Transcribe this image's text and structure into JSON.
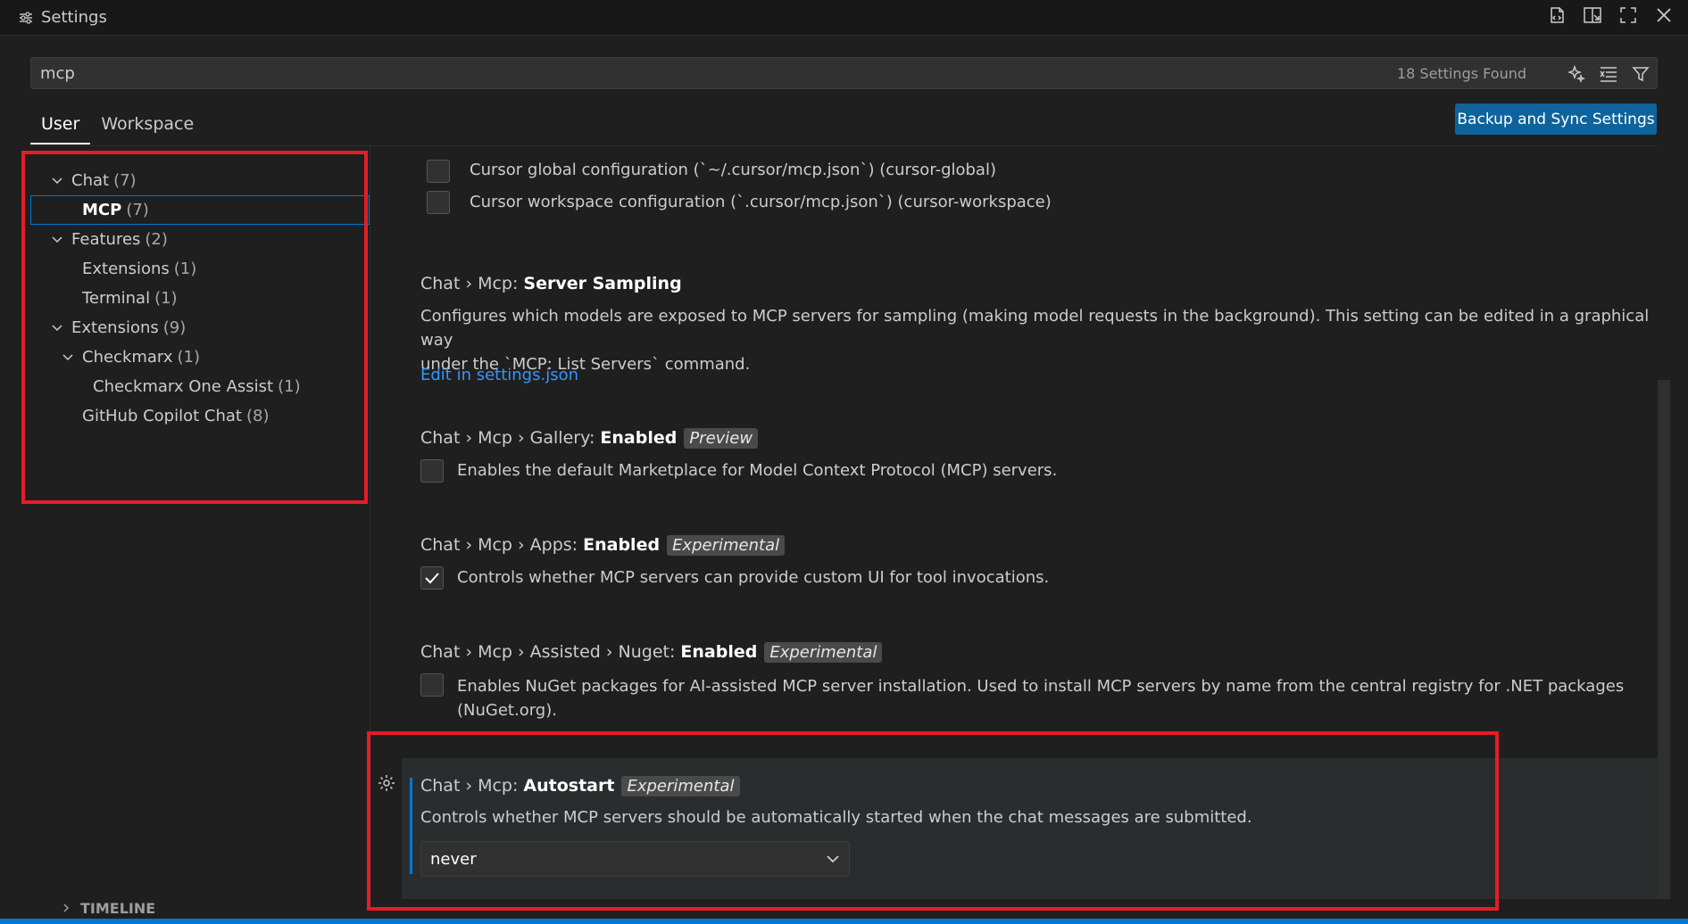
{
  "window": {
    "title": "Settings"
  },
  "search": {
    "value": "mcp",
    "found": "18 Settings Found"
  },
  "tabs": [
    {
      "label": "User",
      "active": true
    },
    {
      "label": "Workspace",
      "active": false
    }
  ],
  "sync_button": "Backup and Sync Settings",
  "toc": [
    {
      "label": "Chat",
      "count": "(7)",
      "level": 0,
      "expanded": true
    },
    {
      "label": "MCP",
      "count": "(7)",
      "level": 1,
      "selected": true
    },
    {
      "label": "Features",
      "count": "(2)",
      "level": 0,
      "expanded": true
    },
    {
      "label": "Extensions",
      "count": "(1)",
      "level": 1
    },
    {
      "label": "Terminal",
      "count": "(1)",
      "level": 1
    },
    {
      "label": "Extensions",
      "count": "(9)",
      "level": 0,
      "expanded": true
    },
    {
      "label": "Checkmarx",
      "count": "(1)",
      "level": 1,
      "expanded": true
    },
    {
      "label": "Checkmarx One Assist",
      "count": "(1)",
      "level": 2
    },
    {
      "label": "GitHub Copilot Chat",
      "count": "(8)",
      "level": 1
    }
  ],
  "settings": {
    "cursor_global": {
      "label": "Cursor global configuration (`~/.cursor/mcp.json`) (cursor-global)",
      "checked": false
    },
    "cursor_workspace": {
      "label": "Cursor workspace configuration (`.cursor/mcp.json`) (cursor-workspace)",
      "checked": false
    },
    "server_sampling": {
      "prefix": "Chat › Mcp: ",
      "name": "Server Sampling",
      "desc_line1": "Configures which models are exposed to MCP servers for sampling (making model requests in the background). This setting can be edited in a graphical way",
      "desc_line2": "under the `MCP: List Servers` command.",
      "link": "Edit in settings.json"
    },
    "gallery": {
      "prefix": "Chat › Mcp › Gallery: ",
      "name": "Enabled",
      "badge": "Preview",
      "label": "Enables the default Marketplace for Model Context Protocol (MCP) servers.",
      "checked": false
    },
    "apps": {
      "prefix": "Chat › Mcp › Apps: ",
      "name": "Enabled",
      "badge": "Experimental",
      "label": "Controls whether MCP servers can provide custom UI for tool invocations.",
      "checked": true
    },
    "nuget": {
      "prefix": "Chat › Mcp › Assisted › Nuget: ",
      "name": "Enabled",
      "badge": "Experimental",
      "label_line1": "Enables NuGet packages for AI-assisted MCP server installation. Used to install MCP servers by name from the central registry for .NET packages",
      "label_line2": "(NuGet.org).",
      "checked": false
    },
    "autostart": {
      "prefix": "Chat › Mcp: ",
      "name": "Autostart",
      "badge": "Experimental",
      "desc": "Controls whether MCP servers should be automatically started when the chat messages are submitted.",
      "value": "never"
    }
  },
  "timeline": "TIMELINE",
  "colors": {
    "accent": "#0078d4",
    "button": "#0e639c",
    "highlight_box": "#e51d25",
    "link": "#3794ff"
  }
}
